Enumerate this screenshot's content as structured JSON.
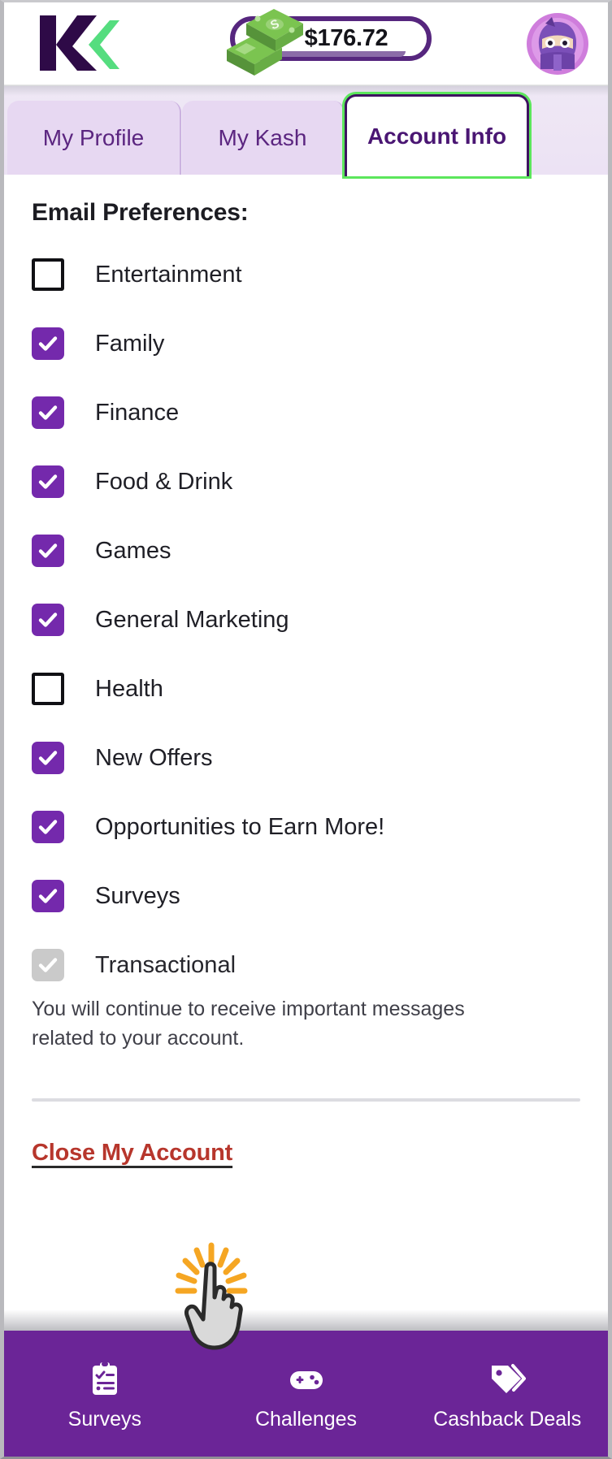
{
  "header": {
    "logo_icon": "kashkick-k-logo",
    "balance": "$176.72",
    "money_icon": "cash-stack-icon",
    "avatar_icon": "ninja-avatar"
  },
  "tabs": [
    {
      "label": "My Profile",
      "active": false
    },
    {
      "label": "My Kash",
      "active": false
    },
    {
      "label": "Account Info",
      "active": true
    }
  ],
  "main": {
    "heading": "Email Preferences:",
    "preferences": [
      {
        "label": "Entertainment",
        "state": "unchecked"
      },
      {
        "label": "Family",
        "state": "checked"
      },
      {
        "label": "Finance",
        "state": "checked"
      },
      {
        "label": "Food & Drink",
        "state": "checked"
      },
      {
        "label": "Games",
        "state": "checked"
      },
      {
        "label": "General Marketing",
        "state": "checked"
      },
      {
        "label": "Health",
        "state": "unchecked"
      },
      {
        "label": "New Offers",
        "state": "checked"
      },
      {
        "label": "Opportunities to Earn More!",
        "state": "checked"
      },
      {
        "label": "Surveys",
        "state": "checked"
      },
      {
        "label": "Transactional",
        "state": "disabled"
      }
    ],
    "transactional_note": "You will continue to receive important messages related to your account.",
    "close_account_link": "Close My Account"
  },
  "bottom_nav": [
    {
      "label": "Surveys",
      "icon": "clipboard-check-icon"
    },
    {
      "label": "Challenges",
      "icon": "gamepad-icon"
    },
    {
      "label": "Cashback Deals",
      "icon": "price-tags-icon"
    }
  ],
  "cursor": {
    "icon": "pointing-hand-cursor-with-click-burst"
  },
  "colors": {
    "brand_purple": "#6b2597",
    "checkbox_purple": "#7429ac",
    "tab_active_border": "#3f1261",
    "focus_ring_green": "#5ce65c",
    "tab_inactive_bg": "#e7d8f2",
    "danger_red": "#b7362c",
    "disabled_grey": "#cacaca",
    "money_green": "#6bbd45"
  }
}
